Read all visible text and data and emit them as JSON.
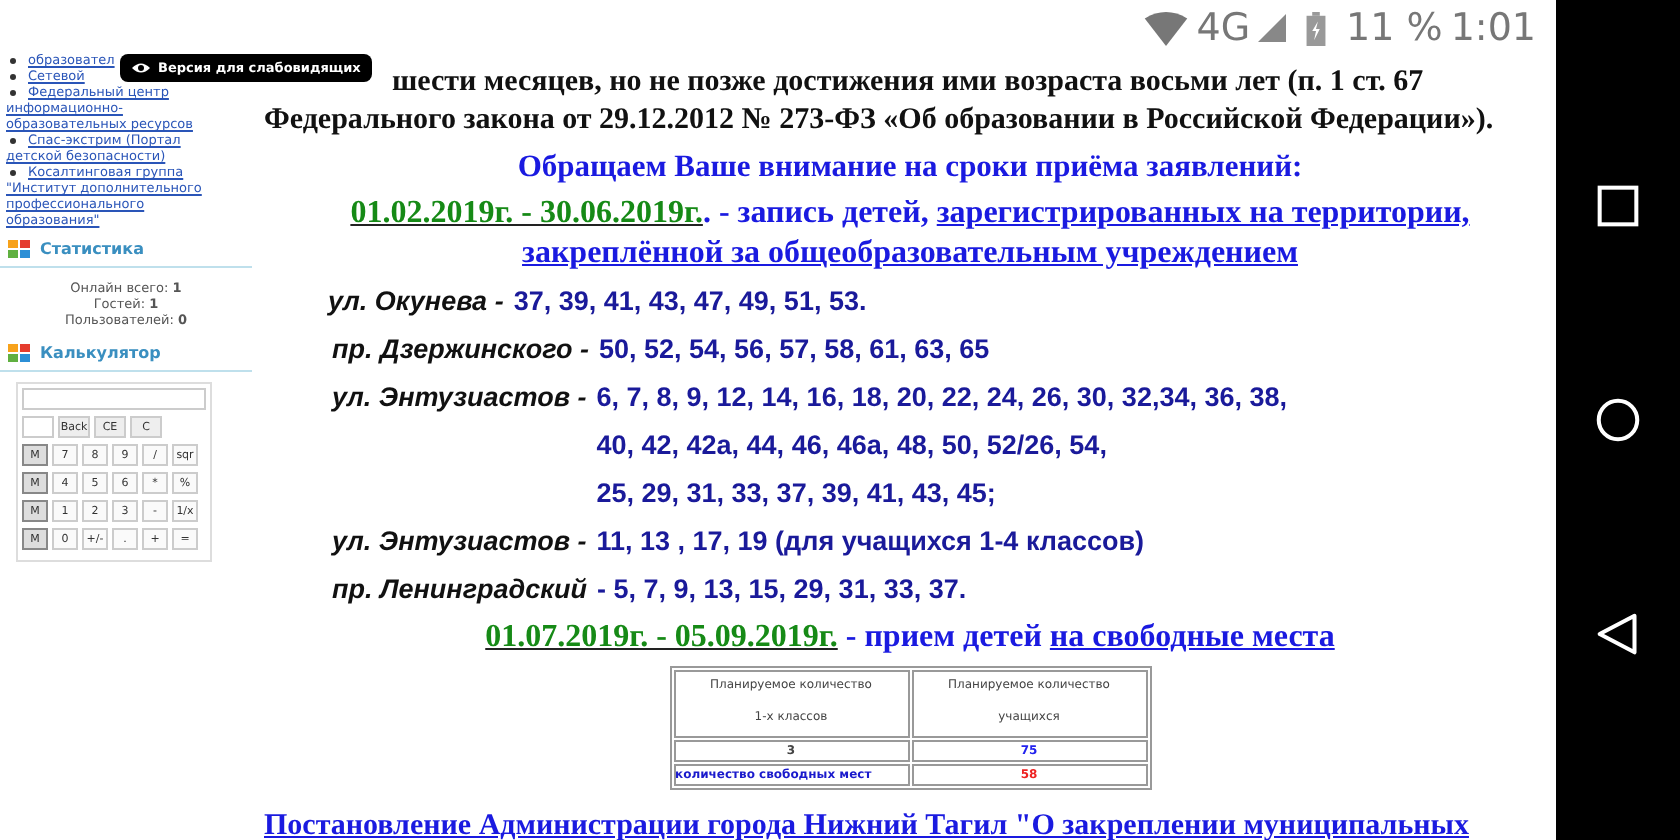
{
  "status_bar": {
    "network": "4G",
    "battery": "11 %",
    "time": "1:01"
  },
  "accessibility_badge": {
    "label": "Версия для слабовидящих"
  },
  "sidebar": {
    "links": [
      {
        "text": "образовател"
      },
      {
        "text": "Сетевой"
      },
      {
        "text": "Федеральный центр информационно-образовательных ресурсов"
      },
      {
        "text": "Спас-экстрим (Портал детской безопасности)"
      },
      {
        "text": "Косалтинговая группа \"Институт дополнительного профессионального образования\""
      }
    ],
    "statistics": {
      "title": "Статистика",
      "lines": [
        {
          "label": "Онлайн всего:",
          "value": "1"
        },
        {
          "label": "Гостей:",
          "value": "1"
        },
        {
          "label": "Пользователей:",
          "value": "0"
        }
      ]
    },
    "calculator": {
      "title": "Калькулятор",
      "top_keys": [
        "Back",
        "CE",
        "C"
      ],
      "rows": [
        [
          "M",
          "7",
          "8",
          "9",
          "/",
          "sqr"
        ],
        [
          "M",
          "4",
          "5",
          "6",
          "*",
          "%"
        ],
        [
          "M",
          "1",
          "2",
          "3",
          "-",
          "1/x"
        ],
        [
          "M",
          "0",
          "+/-",
          ".",
          "+",
          "="
        ]
      ]
    }
  },
  "main": {
    "intro": [
      "шести месяцев, но не позже достижения ими возраста восьми лет (п. 1 ст. 67",
      "Федерального закона от 29.12.2012 № 273-ФЗ «Об образовании в Российской Федерации»)."
    ],
    "heading": "Обращаем Ваше внимание на сроки приёма заявлений:",
    "period_1": {
      "dates": "01.02.2019г. - 30.06.2019г.",
      "text": ". - запись детей, ",
      "link_lines": [
        "зарегистрированных на территории,",
        "закреплённой за общеобразовательным учреждением"
      ]
    },
    "streets": [
      {
        "name": "ул. Окунева -",
        "lines": [
          "37, 39, 41, 43, 47, 49, 51, 53."
        ]
      },
      {
        "name": "пр. Дзержинского -",
        "lines": [
          "50,  52, 54, 56, 57, 58, 61, 63, 65"
        ]
      },
      {
        "name": "ул. Энтузиастов -",
        "lines": [
          "6, 7, 8, 9, 12, 14, 16, 18, 20, 22, 24, 26, 30, 32,34, 36, 38,",
          "40, 42, 42а, 44, 46, 46а, 48, 50, 52/26, 54,",
          "25, 29, 31, 33, 37, 39, 41, 43, 45;"
        ]
      },
      {
        "name": "ул. Энтузиастов -",
        "lines": [
          "11, 13 , 17, 19 (для учащихся 1-4 классов)"
        ]
      },
      {
        "name": "пр. Ленинградский",
        "lines": [
          "- 5, 7, 9, 13, 15, 29, 31, 33, 37."
        ]
      }
    ],
    "period_2": {
      "dates": "01.07.2019г. - 05.09.2019г.",
      "text": " - прием детей ",
      "link": "на свободные места"
    },
    "table": {
      "columns": [
        {
          "line_1": "Планируемое количество",
          "line_2": "1-х классов"
        },
        {
          "line_1": "Планируемое количество",
          "line_2": "учащихся"
        }
      ],
      "rows": [
        [
          {
            "text": "3",
            "color": "#444444"
          },
          {
            "text": "75",
            "color": "#2222ee"
          }
        ],
        [
          {
            "text": "количество свободных мест",
            "color": "#1a1acc"
          },
          {
            "text": "58",
            "color": "#ee2222"
          }
        ]
      ]
    },
    "bottom_link": "Постановление Администрации города Нижний Тагил \"О закреплении муниципальных"
  }
}
